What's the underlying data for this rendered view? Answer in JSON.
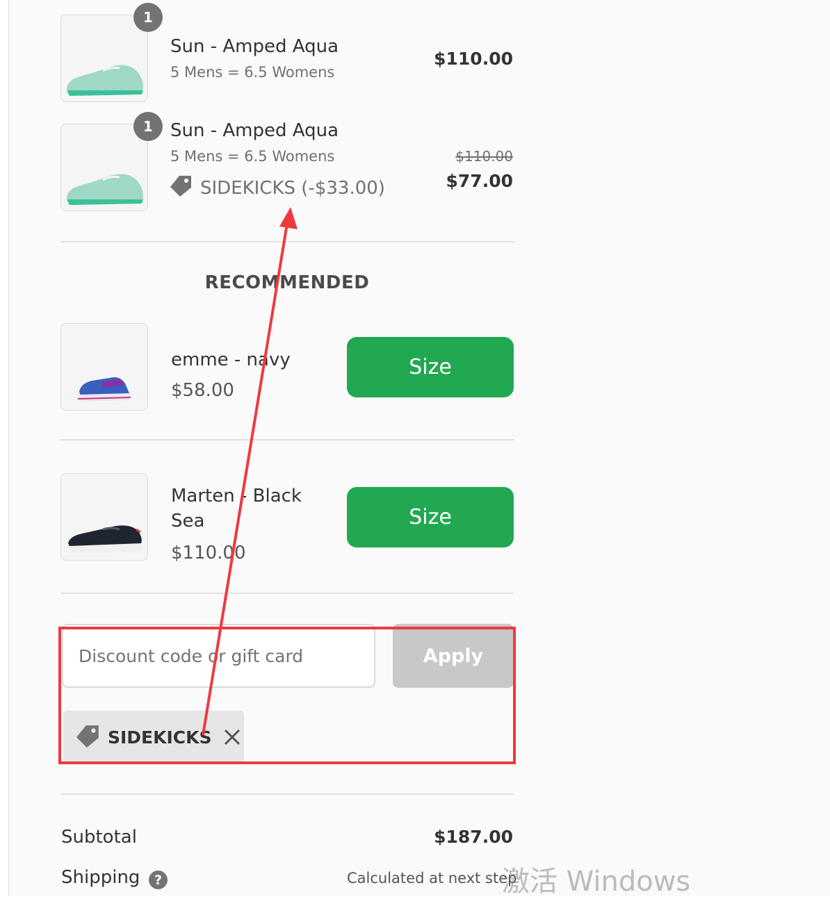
{
  "cart": {
    "items": [
      {
        "quantity": "1",
        "title": "Sun - Amped Aqua",
        "variant": "5 Mens = 6.5 Womens",
        "price": "$110.00"
      },
      {
        "quantity": "1",
        "title": "Sun - Amped Aqua",
        "variant": "5 Mens = 6.5 Womens",
        "discount_label": "SIDEKICKS (-$33.00)",
        "original_price": "$110.00",
        "price": "$77.00"
      }
    ]
  },
  "recommended": {
    "heading": "RECOMMENDED",
    "items": [
      {
        "name": "emme - navy",
        "price": "$58.00",
        "button_label": "Size"
      },
      {
        "name_line1": "Marten - Black",
        "name_line2": "Sea",
        "price": "$110.00",
        "button_label": "Size"
      }
    ]
  },
  "discount": {
    "placeholder": "Discount code or gift card",
    "apply_label": "Apply",
    "applied_code": "SIDEKICKS"
  },
  "summary": {
    "subtotal_label": "Subtotal",
    "subtotal_value": "$187.00",
    "shipping_label": "Shipping",
    "shipping_value": "Calculated at next step",
    "help_glyph": "?"
  },
  "overlay": {
    "watermark": "激活 Windows",
    "annotation_color": "#ee3a3f"
  },
  "colors": {
    "size_button": "#21a851",
    "apply_button_disabled": "#c8c8c8",
    "badge": "#737373"
  }
}
